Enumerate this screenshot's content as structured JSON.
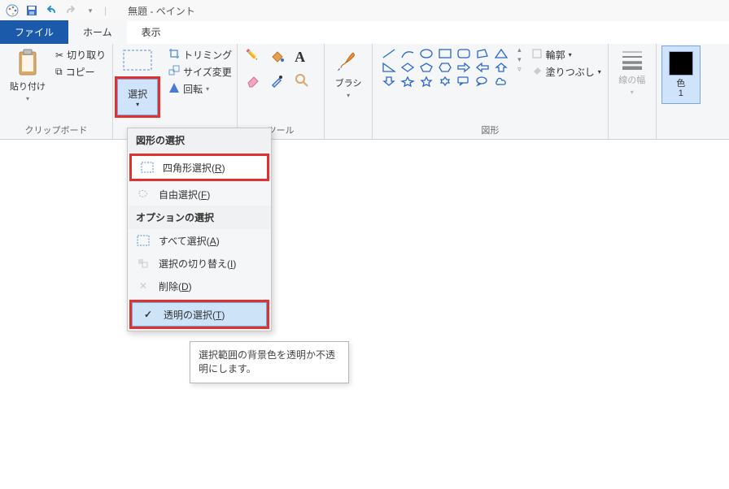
{
  "titlebar": {
    "title": "無題 - ペイント"
  },
  "tabs": {
    "file": "ファイル",
    "home": "ホーム",
    "view": "表示"
  },
  "groups": {
    "clipboard": {
      "label": "クリップボード",
      "paste": "貼り付け",
      "cut": "切り取り",
      "copy": "コピー"
    },
    "image": {
      "select": "選択",
      "crop": "トリミング",
      "resize": "サイズ変更",
      "rotate": "回転"
    },
    "tools": {
      "label": "ツール"
    },
    "brushes": {
      "label": "ブラシ"
    },
    "shapes": {
      "label": "図形",
      "outline": "輪郭",
      "fill": "塗りつぶし"
    },
    "linewidth": {
      "label": "線の幅"
    },
    "color": {
      "label": "色\n1"
    }
  },
  "dropdown": {
    "sectionShapeSel": "図形の選択",
    "rectSel_pre": "四角形選択(",
    "rectSel_u": "R",
    "rectSel_post": ")",
    "freeSel_pre": "自由選択(",
    "freeSel_u": "F",
    "freeSel_post": ")",
    "sectionOption": "オプションの選択",
    "selAll_pre": "すべて選択(",
    "selAll_u": "A",
    "selAll_post": ")",
    "invert_pre": "選択の切り替え(",
    "invert_u": "I",
    "invert_post": ")",
    "delete_pre": "削除(",
    "delete_u": "D",
    "delete_post": ")",
    "transparent_pre": "透明の選択(",
    "transparent_u": "T",
    "transparent_post": ")"
  },
  "tooltip": "選択範囲の背景色を透明か不透明にします。"
}
